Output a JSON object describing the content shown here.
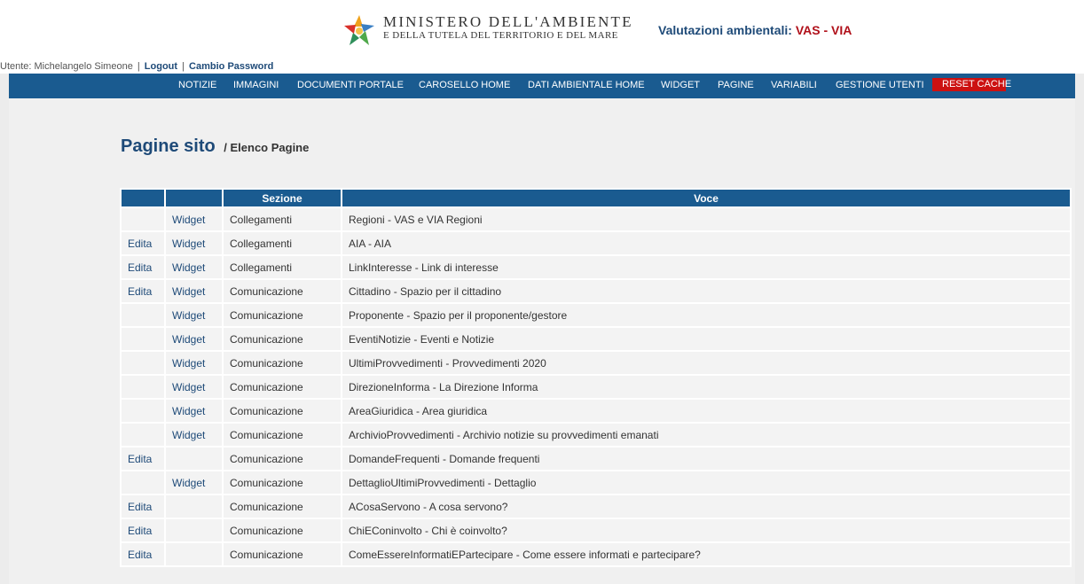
{
  "header": {
    "ministry_line1": "MINISTERO DELL'AMBIENTE",
    "ministry_line2": "E DELLA TUTELA DEL TERRITORIO E DEL MARE",
    "site_title_prefix": "Valutazioni ambientali: ",
    "site_title_accent": "VAS - VIA",
    "logo_colors": [
      "#f0a21c",
      "#3a7fc4",
      "#4fa84a",
      "#d9302a"
    ]
  },
  "user_bar": {
    "user_text": "Utente: Michelangelo Simeone",
    "separator": "|",
    "logout_label": "Logout",
    "change_password_label": "Cambio Password"
  },
  "nav": {
    "items": [
      "NOTIZIE",
      "IMMAGINI",
      "DOCUMENTI PORTALE",
      "CAROSELLO HOME",
      "DATI AMBIENTALE HOME",
      "WIDGET",
      "PAGINE",
      "VARIABILI",
      "GESTIONE UTENTI"
    ],
    "reset_label": "RESET CACHE"
  },
  "page": {
    "title": "Pagine sito",
    "subtitle": "/ Elenco Pagine"
  },
  "table": {
    "headers": [
      "",
      "",
      "Sezione",
      "Voce"
    ],
    "rows": [
      {
        "edit": "",
        "widget": "Widget",
        "sezione": "Collegamenti",
        "voce": "Regioni - VAS e VIA Regioni"
      },
      {
        "edit": "Edita",
        "widget": "Widget",
        "sezione": "Collegamenti",
        "voce": "AIA - AIA"
      },
      {
        "edit": "Edita",
        "widget": "Widget",
        "sezione": "Collegamenti",
        "voce": "LinkInteresse - Link di interesse"
      },
      {
        "edit": "Edita",
        "widget": "Widget",
        "sezione": "Comunicazione",
        "voce": "Cittadino - Spazio per il cittadino"
      },
      {
        "edit": "",
        "widget": "Widget",
        "sezione": "Comunicazione",
        "voce": "Proponente - Spazio per il proponente/gestore"
      },
      {
        "edit": "",
        "widget": "Widget",
        "sezione": "Comunicazione",
        "voce": "EventiNotizie - Eventi e Notizie"
      },
      {
        "edit": "",
        "widget": "Widget",
        "sezione": "Comunicazione",
        "voce": "UltimiProvvedimenti - Provvedimenti 2020"
      },
      {
        "edit": "",
        "widget": "Widget",
        "sezione": "Comunicazione",
        "voce": "DirezioneInforma - La Direzione Informa"
      },
      {
        "edit": "",
        "widget": "Widget",
        "sezione": "Comunicazione",
        "voce": "AreaGiuridica - Area giuridica"
      },
      {
        "edit": "",
        "widget": "Widget",
        "sezione": "Comunicazione",
        "voce": "ArchivioProvvedimenti - Archivio notizie su provvedimenti emanati"
      },
      {
        "edit": "Edita",
        "widget": "",
        "sezione": "Comunicazione",
        "voce": "DomandeFrequenti - Domande frequenti"
      },
      {
        "edit": "",
        "widget": "Widget",
        "sezione": "Comunicazione",
        "voce": "DettaglioUltimiProvvedimenti - Dettaglio"
      },
      {
        "edit": "Edita",
        "widget": "",
        "sezione": "Comunicazione",
        "voce": "ACosaServono - A cosa servono?"
      },
      {
        "edit": "Edita",
        "widget": "",
        "sezione": "Comunicazione",
        "voce": "ChiEConinvolto - Chi è coinvolto?"
      },
      {
        "edit": "Edita",
        "widget": "",
        "sezione": "Comunicazione",
        "voce": "ComeEssereInformatiEPartecipare - Come essere informati e partecipare?"
      }
    ]
  }
}
